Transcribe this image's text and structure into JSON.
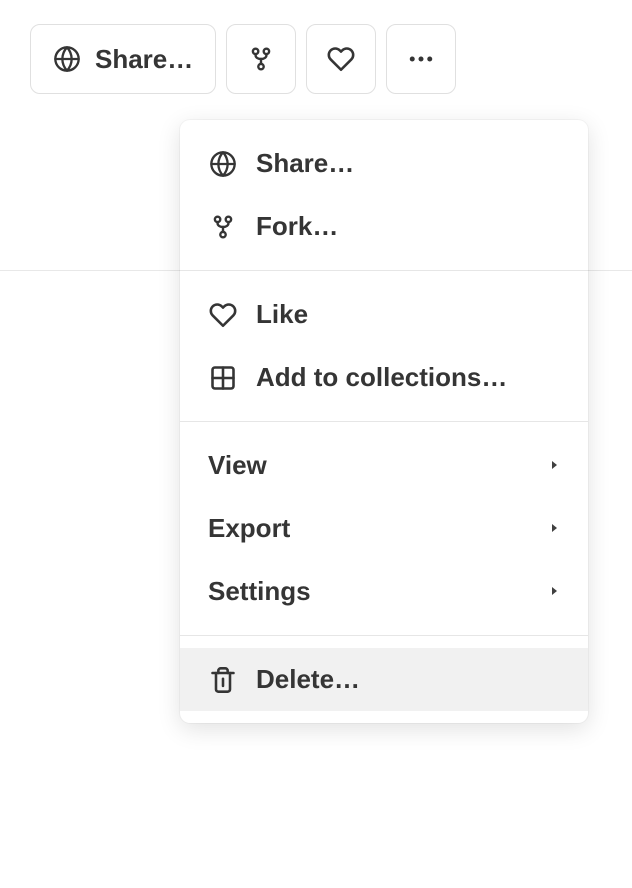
{
  "toolbar": {
    "share_label": "Share…"
  },
  "menu": {
    "group1": {
      "share": "Share…",
      "fork": "Fork…"
    },
    "group2": {
      "like": "Like",
      "add_collections": "Add to collections…"
    },
    "group3": {
      "view": "View",
      "export": "Export",
      "settings": "Settings"
    },
    "group4": {
      "delete": "Delete…"
    }
  }
}
